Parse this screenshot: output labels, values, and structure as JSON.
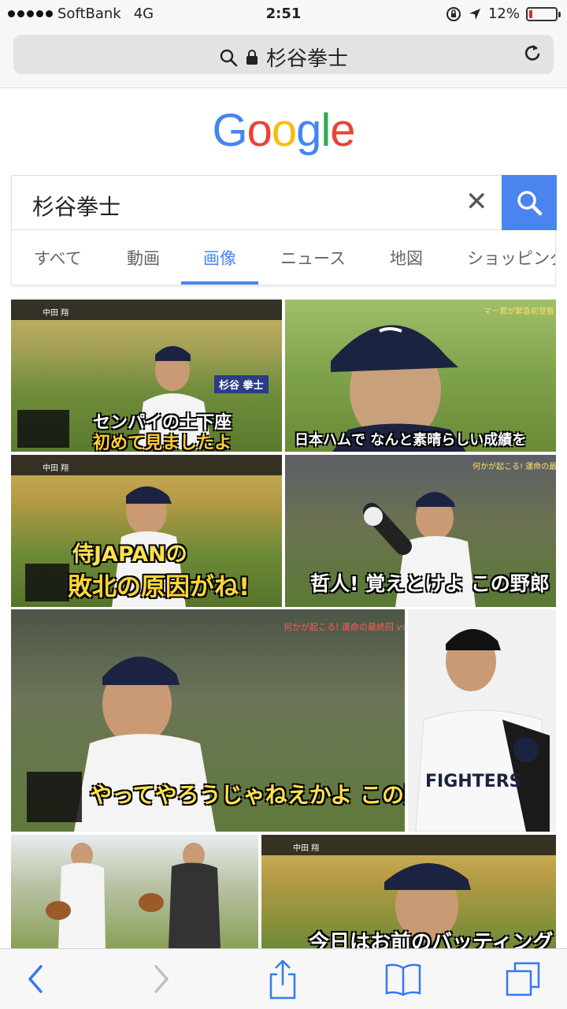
{
  "status": {
    "carrier": "SoftBank",
    "network": "4G",
    "time": "2:51",
    "battery_text": "12%",
    "battery_level": 0.12,
    "battery_color": "#e23"
  },
  "urlbar": {
    "search_icon": "search-icon",
    "lock_icon": "lock-icon",
    "text": "杉谷拳士",
    "reload_icon": "reload-icon"
  },
  "logo": {
    "letters": [
      "G",
      "o",
      "o",
      "g",
      "l",
      "e"
    ],
    "colors": [
      "#4285f4",
      "#ea4335",
      "#fbbc05",
      "#4285f4",
      "#34a853",
      "#ea4335"
    ]
  },
  "search": {
    "query": "杉谷拳士",
    "clear_icon": "close-icon",
    "submit_icon": "search-icon"
  },
  "tabs": [
    {
      "label": "すべて",
      "active": false
    },
    {
      "label": "動画",
      "active": false
    },
    {
      "label": "画像",
      "active": true
    },
    {
      "label": "ニュース",
      "active": false
    },
    {
      "label": "地図",
      "active": false
    },
    {
      "label": "ショッピング",
      "active": false
    }
  ],
  "results": [
    {
      "caption1": "センパイの土下座",
      "caption2": "初めて見ましたよ",
      "name_tag": "杉谷 拳士",
      "overlay": "中田 翔"
    },
    {
      "caption1": "日本ハムで なんと素晴らしい成績を",
      "overlay": "マー君が緊急初登板 vs最強 侍ジャパン"
    },
    {
      "caption1": "侍JAPANの",
      "caption2": "敗北の原因がね!",
      "overlay": "中田 翔"
    },
    {
      "caption1": "哲人! 覚えとけよ この野郎",
      "overlay": "何かが起こる! 運命の最終回 vs侍ジャパン 因縁の対決"
    },
    {
      "caption1": "やってやろうじゃねえかよ この野郎!",
      "overlay": "何かが起こる! 運命の最終回 vs侍ジャパン 因縁の対決"
    },
    {
      "caption1": "FIGHTERS"
    },
    {
      "caption1": ""
    },
    {
      "caption1": "今日はお前のバッティング",
      "overlay": "中田 翔"
    }
  ],
  "toolbar": {
    "back_icon": "back-chevron-icon",
    "forward_icon": "forward-chevron-icon",
    "share_icon": "share-icon",
    "bookmarks_icon": "bookmarks-icon",
    "tabs_icon": "tabs-icon"
  }
}
